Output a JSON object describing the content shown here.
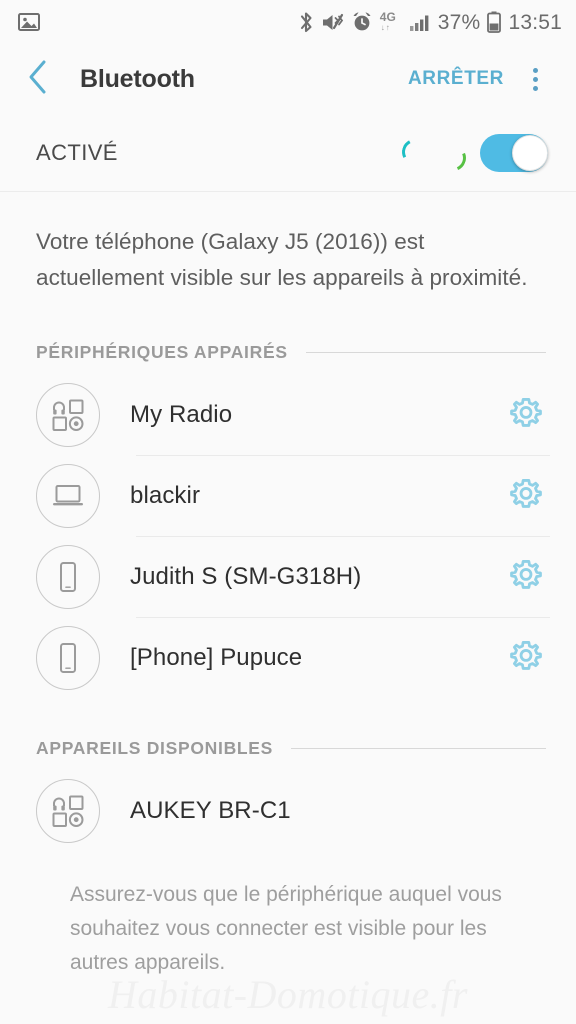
{
  "status_bar": {
    "left_icons": [
      {
        "name": "photo-icon",
        "label": "image"
      }
    ],
    "right_icons": [
      {
        "name": "bluetooth-icon",
        "label": "bluetooth"
      },
      {
        "name": "mute-vibrate-icon",
        "label": "sound-off"
      },
      {
        "name": "alarm-clock-icon",
        "label": "alarm"
      },
      {
        "name": "network-4g-icon",
        "label": "4G"
      },
      {
        "name": "signal-strength-icon",
        "label": "signal"
      }
    ],
    "network_label": "4G",
    "network_arrows": "⇵",
    "battery_percent": "37%",
    "time": "13:51"
  },
  "app_bar": {
    "back_icon": "chevron-left-icon",
    "title": "Bluetooth",
    "action_label": "ARRÊTER",
    "overflow_icon": "more-vertical-icon"
  },
  "toggle_section": {
    "label": "ACTIVÉ",
    "switch_state": "on",
    "scanning": true,
    "colors": {
      "track_on": "#4fbbe4",
      "thumb": "#ffffff",
      "spinner_teal": "#1dbfc4",
      "spinner_green": "#57c144"
    }
  },
  "description": "Votre téléphone (Galaxy J5 (2016)) est actuellement visible sur les appareils à proximité.",
  "sections": {
    "paired": {
      "title": "PÉRIPHÉRIQUES APPAIRÉS",
      "devices": [
        {
          "name": "My Radio",
          "icon": "generic-device-icon",
          "has_settings": true
        },
        {
          "name": "blackir",
          "icon": "laptop-icon",
          "has_settings": true
        },
        {
          "name": "Judith S (SM-G318H)",
          "icon": "phone-icon",
          "has_settings": true
        },
        {
          "name": "[Phone] Pupuce",
          "icon": "phone-icon",
          "has_settings": true
        }
      ]
    },
    "available": {
      "title": "APPAREILS DISPONIBLES",
      "devices": [
        {
          "name": "AUKEY BR-C1",
          "icon": "generic-device-icon",
          "has_settings": false
        }
      ]
    }
  },
  "footer_note": "Assurez-vous que le périphérique auquel vous souhaitez vous connecter est visible pour les autres appareils.",
  "watermark": "Habitat-Domotique.fr",
  "theme": {
    "accent": "#5aafd0",
    "gear": "#8fd0e6",
    "background": "#fafafa",
    "text_primary": "#2f2f2f",
    "text_secondary": "#5e5e5e",
    "text_muted": "#9a9a9a"
  }
}
